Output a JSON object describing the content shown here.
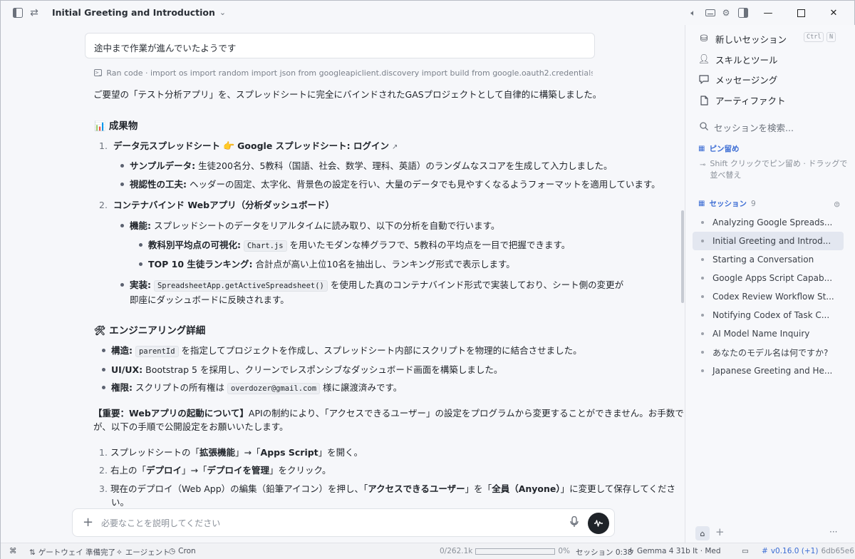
{
  "app": {
    "chat_title": "Initial Greeting and Introduction"
  },
  "conversation": {
    "user_message": "途中まで作業が進んでいたようです",
    "ran_code": "Ran code · import os import random import json from googleapiclient.discovery import build from google.oauth2.credentials import Cr",
    "intro": "ご要望の「テスト分析アプリ」を、スプレッドシートに完全にバインドされたGASプロジェクトとして自律的に構築しました。",
    "deliverables_heading": "成果物",
    "item1_num": "1.",
    "item1_title": "データ元スプレッドシート",
    "item1_link": "Google スプレッドシート: ログイン",
    "item1_sub1_label": "サンプルデータ:",
    "item1_sub1_text": " 生徒200名分、5教科（国語、社会、数学、理科、英語）のランダムなスコアを生成して入力しました。",
    "item1_sub2_label": "視認性の工夫:",
    "item1_sub2_text": " ヘッダーの固定、太字化、背景色の設定を行い、大量のデータでも見やすくなるようフォーマットを適用しています。",
    "item2_num": "2.",
    "item2_title": "コンテナバインド Webアプリ（分析ダッシュボード）",
    "item2_sub1_label": "機能:",
    "item2_sub1_text": " スプレッドシートのデータをリアルタイムに読み取り、以下の分析を自動で行います。",
    "item2_sub1a_label": "教科別平均点の可視化:",
    "item2_sub1a_code": "Chart.js",
    "item2_sub1a_text": " を用いたモダンな棒グラフで、5教科の平均点を一目で把握できます。",
    "item2_sub1b_label": "TOP 10 生徒ランキング:",
    "item2_sub1b_text": " 合計点が高い上位10名を抽出し、ランキング形式で表示します。",
    "item2_sub2_label": "実装:",
    "item2_sub2_code": "SpreadsheetApp.getActiveSpreadsheet()",
    "item2_sub2_text": " を使用した真のコンテナバインド形式で実装しており、シート側の変更が",
    "item2_sub2_text2": "即座にダッシュボードに反映されます。",
    "eng_heading": "エンジニアリング詳細",
    "eng1_label": "構造:",
    "eng1_code": "parentId",
    "eng1_text": " を指定してプロジェクトを作成し、スプレッドシート内部にスクリプトを物理的に結合させました。",
    "eng2_label": "UI/UX:",
    "eng2_text": " Bootstrap 5 を採用し、クリーンでレスポンシブなダッシュボード画面を構築しました。",
    "eng3_label": "権限:",
    "eng3_text_pre": " スクリプトの所有権は ",
    "eng3_code": "overdozer@gmail.com",
    "eng3_text_post": " 様に譲渡済みです。",
    "notice_bold": "【重要：Webアプリの起動について】",
    "notice_text": "APIの制約により、「アクセスできるユーザー」の設定をプログラムから変更することができません。お手数です",
    "notice_text2": "が、以下の手順で公開設定をお願いいたします。",
    "step1_num": "1.",
    "step1_a": "スプレッドシートの「",
    "step1_b": "拡張機能",
    "step1_c": "」→「",
    "step1_d": "Apps Script",
    "step1_e": "」を開く。",
    "step2_num": "2.",
    "step2_a": "右上の「",
    "step2_b": "デプロイ",
    "step2_c": "」→「",
    "step2_d": "デプロイを管理",
    "step2_e": "」をクリック。",
    "step3_num": "3.",
    "step3_a": "現在のデプロイ（Web App）の編集（鉛筆アイコン）を押し、「",
    "step3_b": "アクセスできるユーザー",
    "step3_c": "」を「",
    "step3_d": "全員（Anyone）",
    "step3_e": "」に変更して保存してくださ",
    "step3_f": "い。"
  },
  "composer": {
    "placeholder": "必要なことを説明してください"
  },
  "sidebar": {
    "new_session": "新しいセッション",
    "kbd_ctrl": "Ctrl",
    "kbd_n": "N",
    "skills": "スキルとツール",
    "messaging": "メッセージング",
    "artifacts": "アーティファクト",
    "search_placeholder": "セッションを検索...",
    "pinned_label": "ピン留め",
    "pinned_hint": "Shift クリックでピン留め · ドラッグで並べ替え",
    "sessions_label": "セッション",
    "sessions_count": "9",
    "sessions": [
      "Analyzing Google Spreads...",
      "Initial Greeting and Introd...",
      "Starting a Conversation",
      "Google Apps Script Capab...",
      "Codex Review Workflow St...",
      "Notifying Codex of Task C...",
      "AI Model Name Inquiry",
      "あなたのモデル名は何ですか?",
      "Japanese Greeting and He..."
    ],
    "active_index": 1
  },
  "statusbar": {
    "gateway": "ゲートウェイ 準備完了",
    "agent": "エージェント",
    "cron": "Cron",
    "tokens": "0/262.1k",
    "context_pct": "0%",
    "context_fraction": 0.0,
    "session": "セッション 0:38",
    "model": "Gemma 4 31b It · Med",
    "version": "v0.16.0 (+1)",
    "commit": "6db65e6"
  },
  "colors": {
    "accent": "#3b6cd4",
    "active_row": "#e3e7f0"
  }
}
